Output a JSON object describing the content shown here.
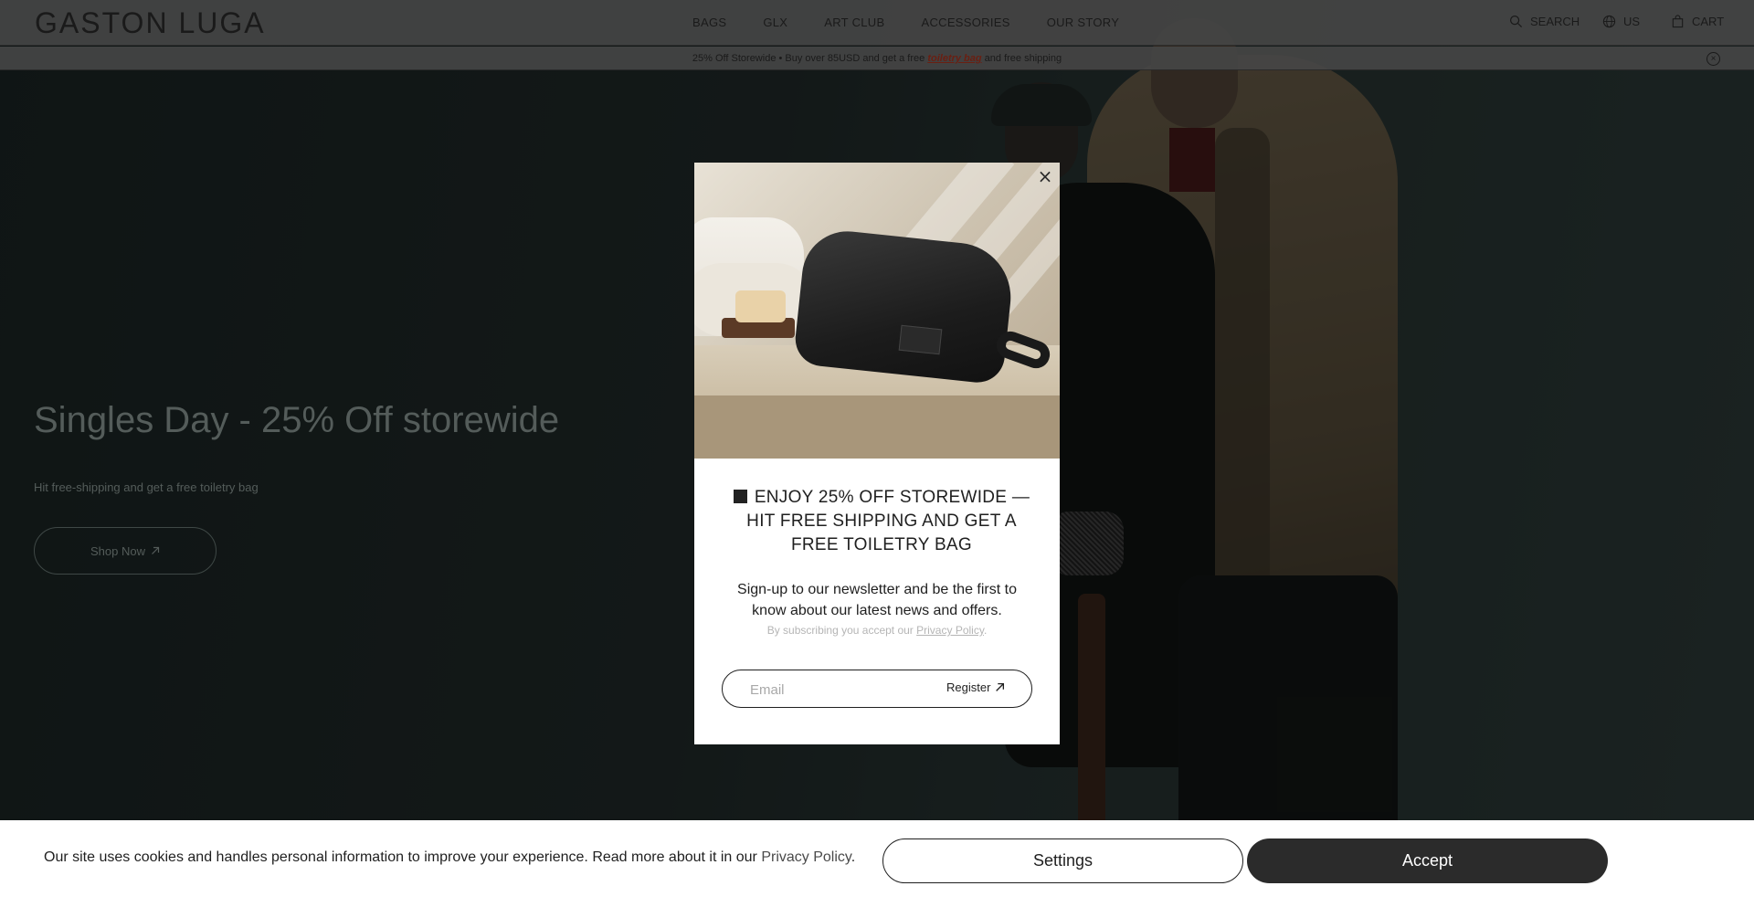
{
  "header": {
    "logo": "GASTON LUGA",
    "nav": [
      "BAGS",
      "GLX",
      "ART CLUB",
      "ACCESSORIES",
      "OUR STORY"
    ],
    "search_label": "SEARCH",
    "region_label": "US",
    "cart_label": "CART"
  },
  "announcement": {
    "text_before": "25% Off Storewide • Buy over 85USD and get a free ",
    "link": "toiletry bag",
    "text_after": " and free shipping"
  },
  "hero": {
    "title": "Singles Day - 25% Off storewide",
    "subtitle": "Hit free-shipping and get a free toiletry bag",
    "cta": "Shop Now"
  },
  "modal": {
    "close": "×",
    "heading": "ENJOY 25% OFF STOREWIDE — HIT FREE SHIPPING AND GET A FREE TOILETRY BAG",
    "description": "Sign-up to our newsletter and be the first to know about our latest news and offers.",
    "note_before": "By subscribing you accept our ",
    "note_link": "Privacy Policy",
    "note_after": ".",
    "email_placeholder": "Email",
    "register_label": "Register"
  },
  "cookie": {
    "text_before": "Our site uses cookies and handles personal information to improve your experience. Read more about it in our ",
    "link": "Privacy Policy",
    "text_after": ".",
    "settings_label": "Settings",
    "accept_label": "Accept"
  }
}
